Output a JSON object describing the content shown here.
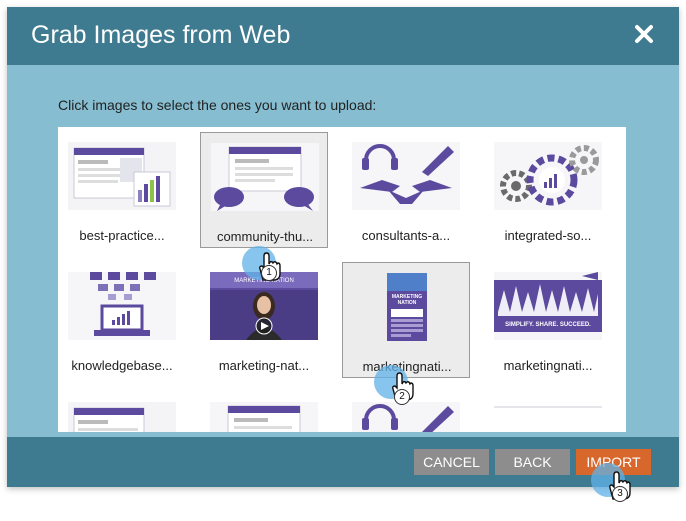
{
  "dialog": {
    "title": "Grab Images from Web",
    "instruction": "Click images to select the ones you want to upload:"
  },
  "images": [
    {
      "label": "best-practice..."
    },
    {
      "label": "community-thu..."
    },
    {
      "label": "consultants-a..."
    },
    {
      "label": "integrated-so..."
    },
    {
      "label": "knowledgebase..."
    },
    {
      "label": "marketing-nat..."
    },
    {
      "label": "marketingnati..."
    },
    {
      "label": "marketingnati..."
    }
  ],
  "thumb_text": {
    "marketing_nation": "MARKETING NATION",
    "marketing": "MARKETING",
    "nation": "NATION",
    "slogan": "SIMPLIFY. SHARE. SUCCEED."
  },
  "buttons": {
    "cancel": "CANCEL",
    "back": "BACK",
    "import": "IMPORT"
  },
  "steps": [
    "1",
    "2",
    "3"
  ],
  "colors": {
    "header": "#3f7b90",
    "body": "#86bdd0",
    "accent_purple": "#5b4a9e",
    "import_button": "#d8672b",
    "neutral_button": "#8d8d8d",
    "click_marker": "#60b2e8"
  }
}
